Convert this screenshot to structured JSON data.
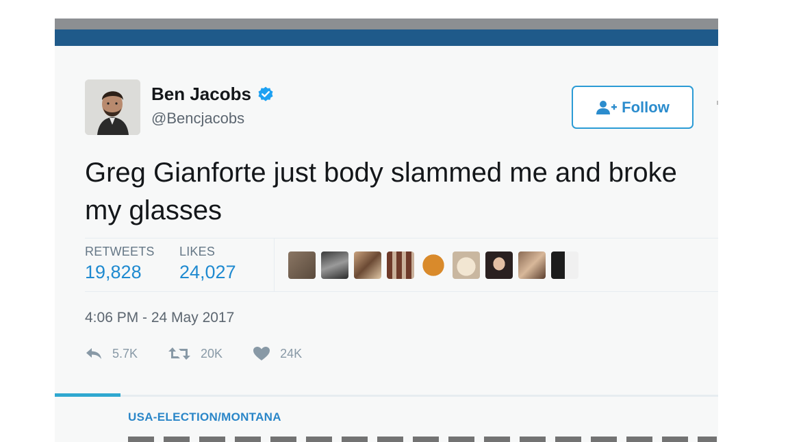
{
  "tweet": {
    "author_name": "Ben Jacobs",
    "author_handle": "@Bencjacobs",
    "follow_label": "Follow",
    "text": "Greg Gianforte just body slammed me and broke my glasses",
    "stats": {
      "retweets_label": "RETWEETS",
      "retweets_value": "19,828",
      "likes_label": "LIKES",
      "likes_value": "24,027"
    },
    "timestamp": "4:06 PM - 24 May 2017",
    "actions": {
      "reply_count": "5.7K",
      "retweet_count": "20K",
      "like_count": "24K"
    }
  },
  "article": {
    "category": "USA-ELECTION/MONTANA"
  },
  "icons": {
    "verified": "verified-badge-icon",
    "follow": "add-user-icon",
    "reply": "reply-icon",
    "retweet": "retweet-icon",
    "like": "heart-icon"
  },
  "colors": {
    "header_blue": "#1f5a8a",
    "accent_blue": "#2b8ccd",
    "verified_blue": "#1da1f2",
    "text_dark": "#14171a",
    "text_grey": "#5c6670"
  }
}
